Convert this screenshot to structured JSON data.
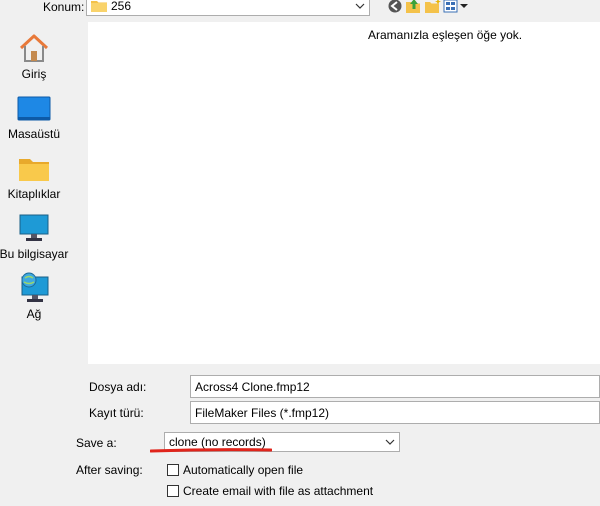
{
  "location": {
    "label": "Konum:",
    "value": "256"
  },
  "toolbar": {
    "back_icon": "back-arrow-icon",
    "up_icon": "up-folder-icon",
    "new_folder_icon": "new-folder-icon",
    "view_menu_icon": "view-menu-icon"
  },
  "places": [
    {
      "label": "Giriş",
      "icon": "home-icon"
    },
    {
      "label": "Masaüstü",
      "icon": "desktop-icon"
    },
    {
      "label": "Kitaplıklar",
      "icon": "libraries-icon"
    },
    {
      "label": "Bu bilgisayar",
      "icon": "this-pc-icon"
    },
    {
      "label": "Ağ",
      "icon": "network-icon"
    }
  ],
  "file_list": {
    "empty_message": "Aramanızla eşleşen öğe yok."
  },
  "file_name": {
    "label": "Dosya adı:",
    "value": "Across4 Clone.fmp12"
  },
  "file_type": {
    "label": "Kayıt türü:",
    "value": "FileMaker Files (*.fmp12)"
  },
  "save_as": {
    "label": "Save a:",
    "value": "clone (no records)"
  },
  "after_saving": {
    "label": "After saving:",
    "option1": "Automatically open file",
    "option2": "Create email with file as attachment"
  },
  "colors": {
    "annotation_red": "#e0241b",
    "folder_yellow": "#f4c24a",
    "accent_blue": "#1e88e5"
  }
}
